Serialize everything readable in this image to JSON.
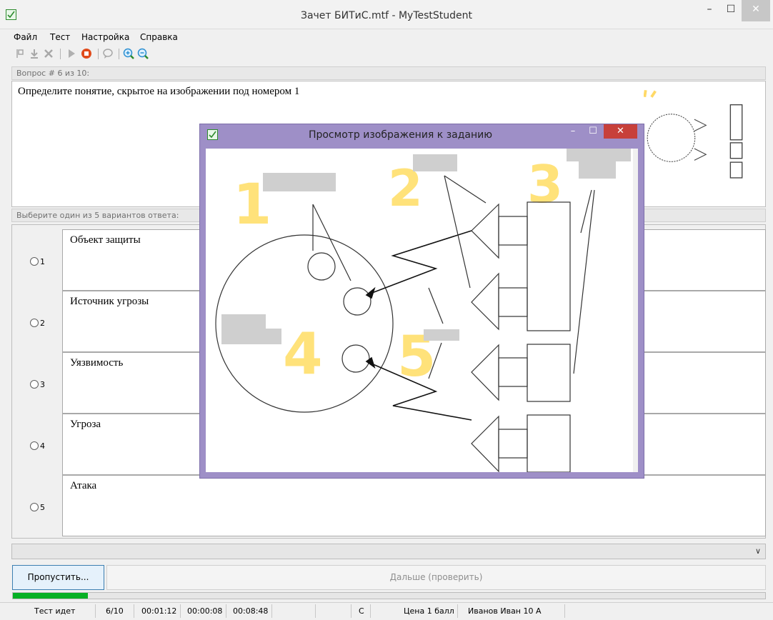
{
  "window": {
    "title": "Зачет БИТиС.mtf - MyTestStudent",
    "min_glyph": "–",
    "max_glyph": "☐",
    "close_glyph": "✕"
  },
  "menu": [
    "Файл",
    "Тест",
    "Настройка",
    "Справка"
  ],
  "toolbar_icons": [
    "flag-icon",
    "download-icon",
    "cancel-icon",
    "play-icon",
    "stop-icon",
    "comment-icon",
    "zoom-in-icon",
    "zoom-out-icon"
  ],
  "question": {
    "header": "Вопрос # 6 из 10:",
    "text": "Определите понятие, скрытое на изображении под номером 1"
  },
  "answers_header": "Выберите один из 5 вариантов ответа:",
  "answers": [
    {
      "num": "1",
      "text": "Объект защиты"
    },
    {
      "num": "2",
      "text": "Источник угрозы"
    },
    {
      "num": "3",
      "text": "Уязвимость"
    },
    {
      "num": "4",
      "text": "Угроза"
    },
    {
      "num": "5",
      "text": "Атака"
    }
  ],
  "buttons": {
    "skip": "Пропустить...",
    "next": "Дальше (проверить)"
  },
  "progress": 0.1,
  "status": {
    "state": "Тест идет",
    "counter": "6/10",
    "time1": "00:01:12",
    "time2": "00:00:08",
    "time3": "00:08:48",
    "mode": "С",
    "price": "Цена 1 балл",
    "student": "Иванов Иван 10 А"
  },
  "dialog": {
    "title": "Просмотр изображения к заданию",
    "min_glyph": "–",
    "max_glyph": "☐",
    "close_glyph": "✕",
    "labels": [
      "1",
      "2",
      "3",
      "4",
      "5"
    ]
  },
  "colors": {
    "dialog_frame": "#9e8fc7",
    "close_red": "#c7403a",
    "progress_green": "#06b025",
    "label_yellow": "#ffe27a"
  }
}
